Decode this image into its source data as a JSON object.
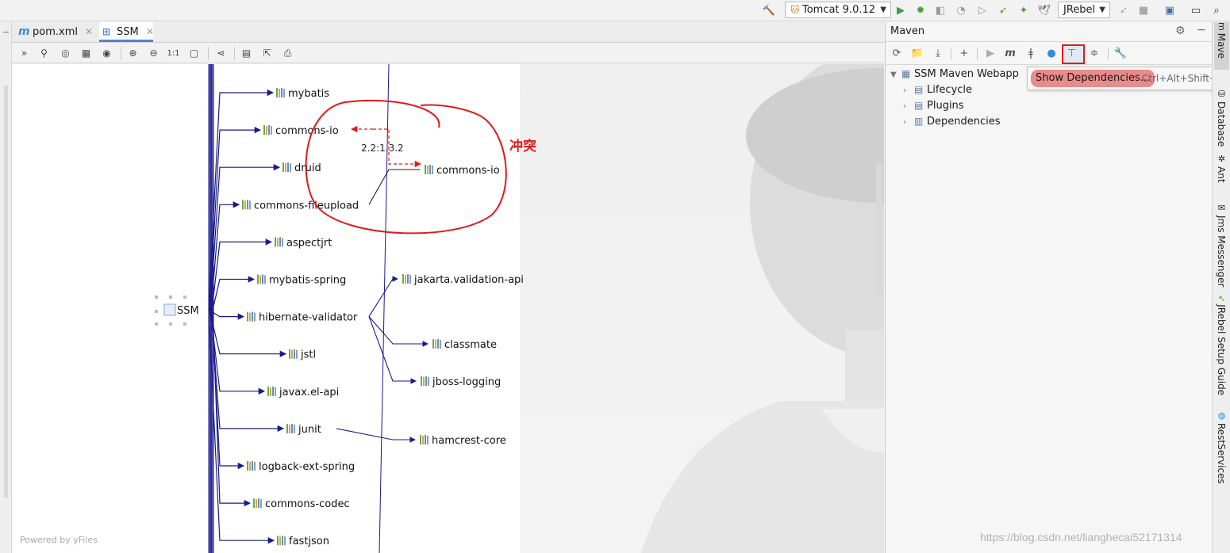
{
  "run_toolbar": {
    "run_config": "Tomcat 9.0.12",
    "jrebel_select": "JRebel",
    "icons": [
      "hammer-icon",
      "run-icon",
      "debug-icon",
      "coverage-icon",
      "profile-icon",
      "run-dashboard-icon",
      "jrebel-run-icon",
      "jrebel-debug-icon",
      "jrebel-bird-icon",
      "stop-icon",
      "project-structure-icon",
      "terminal-icon",
      "search-icon"
    ]
  },
  "tabs": [
    {
      "label": "pom.xml",
      "icon": "m"
    },
    {
      "label": "SSM",
      "icon": "diagram-icon"
    }
  ],
  "diagram": {
    "root": "SSM",
    "dependencies": [
      "mybatis",
      "commons-io",
      "druid",
      "commons-fileupload",
      "aspectjrt",
      "mybatis-spring",
      "hibernate-validator",
      "jstl",
      "javax.el-api",
      "junit",
      "logback-ext-spring",
      "commons-codec",
      "fastjson"
    ],
    "transitive": [
      {
        "parent": "commons-fileupload",
        "child": "commons-io"
      },
      {
        "parent": "hibernate-validator",
        "child": "jakarta.validation-api"
      },
      {
        "parent": "hibernate-validator",
        "child": "classmate"
      },
      {
        "parent": "hibernate-validator",
        "child": "jboss-logging"
      },
      {
        "parent": "junit",
        "child": "hamcrest-core"
      }
    ],
    "conflict_versions": "2.2:1.3.2",
    "conflict_annotation": "冲突",
    "powered_by": "Powered by yFiles"
  },
  "maven": {
    "title": "Maven",
    "tree": {
      "root": "SSM Maven Webapp",
      "children": [
        "Lifecycle",
        "Plugins",
        "Dependencies"
      ]
    },
    "tooltip": {
      "action": "Show Dependencies...",
      "shortcut": "Ctrl+Alt+Shift+U"
    }
  },
  "right_strip": [
    "Mave",
    "Database",
    "Ant",
    "Jms Messenger",
    "JRebel Setup Guide",
    "RestServices"
  ],
  "watermark": "https://blog.csdn.net/lianghecai52171314",
  "colors": {
    "edge": "#1a1a8c",
    "conflict": "#e01a1a",
    "accent": "#4a88c7"
  }
}
